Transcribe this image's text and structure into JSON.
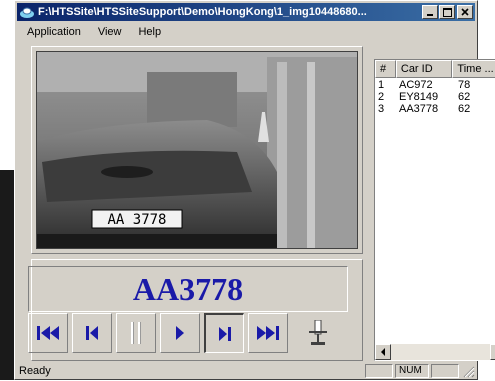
{
  "window": {
    "title": "F:\\HTSSite\\HTSSiteSupport\\Demo\\HongKong\\1_img10448680...",
    "buttons": {
      "minimize": "_",
      "maximize": "□",
      "close": "×"
    }
  },
  "menu": {
    "application": "Application",
    "view": "View",
    "help": "Help"
  },
  "video": {
    "plate_text": "AA 3778"
  },
  "recognized_plate": "AA3778",
  "controls": [
    {
      "name": "first-frame",
      "icon": "skip-to-start-icon"
    },
    {
      "name": "previous-frame",
      "icon": "step-back-icon"
    },
    {
      "name": "pause",
      "icon": "pause-icon"
    },
    {
      "name": "play",
      "icon": "play-icon"
    },
    {
      "name": "next-frame",
      "icon": "step-forward-icon"
    },
    {
      "name": "last-frame",
      "icon": "skip-to-end-icon"
    },
    {
      "name": "trigger",
      "icon": "trigger-sensor-icon"
    }
  ],
  "list": {
    "columns": [
      "#",
      "Car ID",
      "Time ..."
    ],
    "rows": [
      {
        "num": "1",
        "car_id": "AC972",
        "time": "78"
      },
      {
        "num": "2",
        "car_id": "EY8149",
        "time": "62"
      },
      {
        "num": "3",
        "car_id": "AA3778",
        "time": "62"
      }
    ]
  },
  "status": {
    "text": "Ready",
    "num_indicator": "NUM"
  }
}
